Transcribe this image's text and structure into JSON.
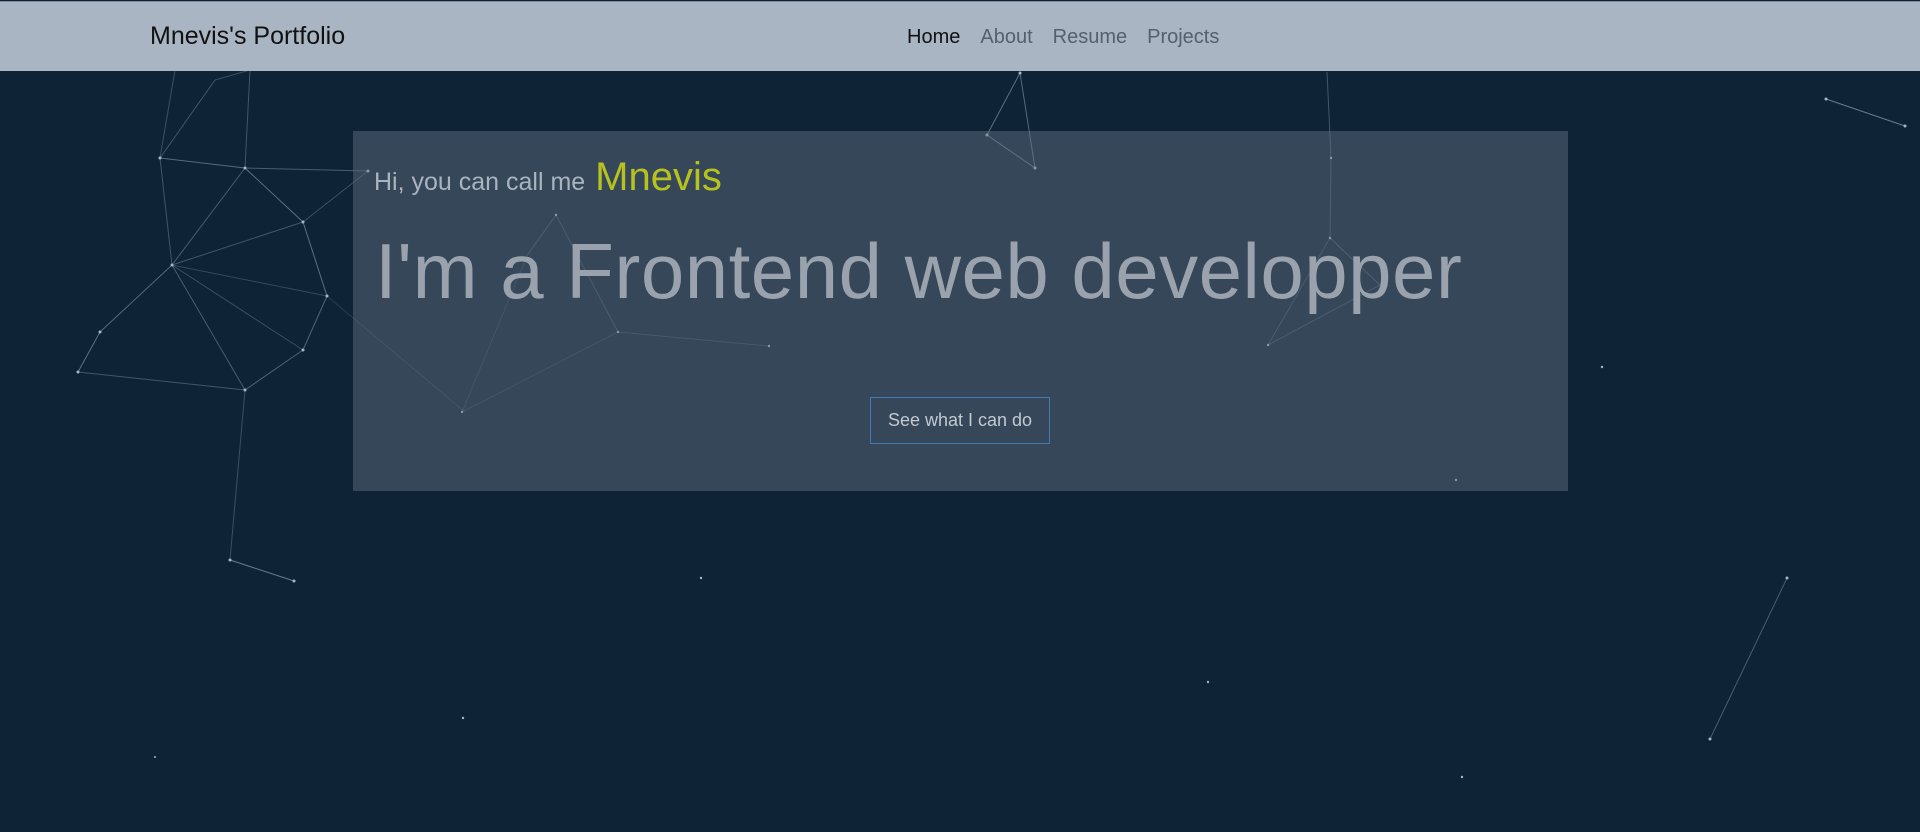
{
  "navbar": {
    "brand": "Mnevis's Portfolio",
    "links": [
      {
        "label": "Home",
        "active": true
      },
      {
        "label": "About",
        "active": false
      },
      {
        "label": "Resume",
        "active": false
      },
      {
        "label": "Projects",
        "active": false
      }
    ]
  },
  "hero": {
    "greeting_prefix": "Hi, you can call me",
    "name": "Mnevis",
    "headline": "I'm a Frontend web developper",
    "cta_label": "See what I can do"
  },
  "colors": {
    "background": "#0f2337",
    "navbar": "#a9b5c3",
    "accent_name": "#b7c21e",
    "cta_border": "#3f7ab5"
  }
}
